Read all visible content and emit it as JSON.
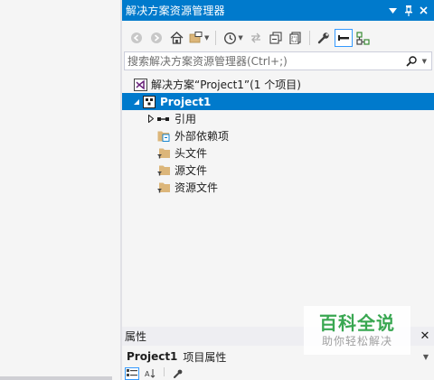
{
  "window": {
    "title": "解决方案资源管理器",
    "title_controls": [
      {
        "name": "window-menu-icon",
        "glyph": "▼"
      },
      {
        "name": "pin-icon",
        "glyph": "📌"
      },
      {
        "name": "close-icon",
        "glyph": "✕"
      }
    ]
  },
  "search": {
    "placeholder": "搜索解决方案资源管理器(Ctrl+;)",
    "value": ""
  },
  "tree": {
    "solution_label": "解决方案“Project1”(1 个项目)",
    "project_label": "Project1",
    "items": [
      {
        "label": "引用"
      },
      {
        "label": "外部依赖项"
      },
      {
        "label": "头文件"
      },
      {
        "label": "源文件"
      },
      {
        "label": "资源文件"
      }
    ]
  },
  "properties": {
    "title": "属性",
    "object_name": "Project1",
    "object_type": "项目属性"
  },
  "watermark": {
    "title": "百科全说",
    "subtitle": "助你轻松解决"
  },
  "colors": {
    "accent": "#007acc",
    "folder": "#dcb67a",
    "vs_purple": "#68217a"
  }
}
